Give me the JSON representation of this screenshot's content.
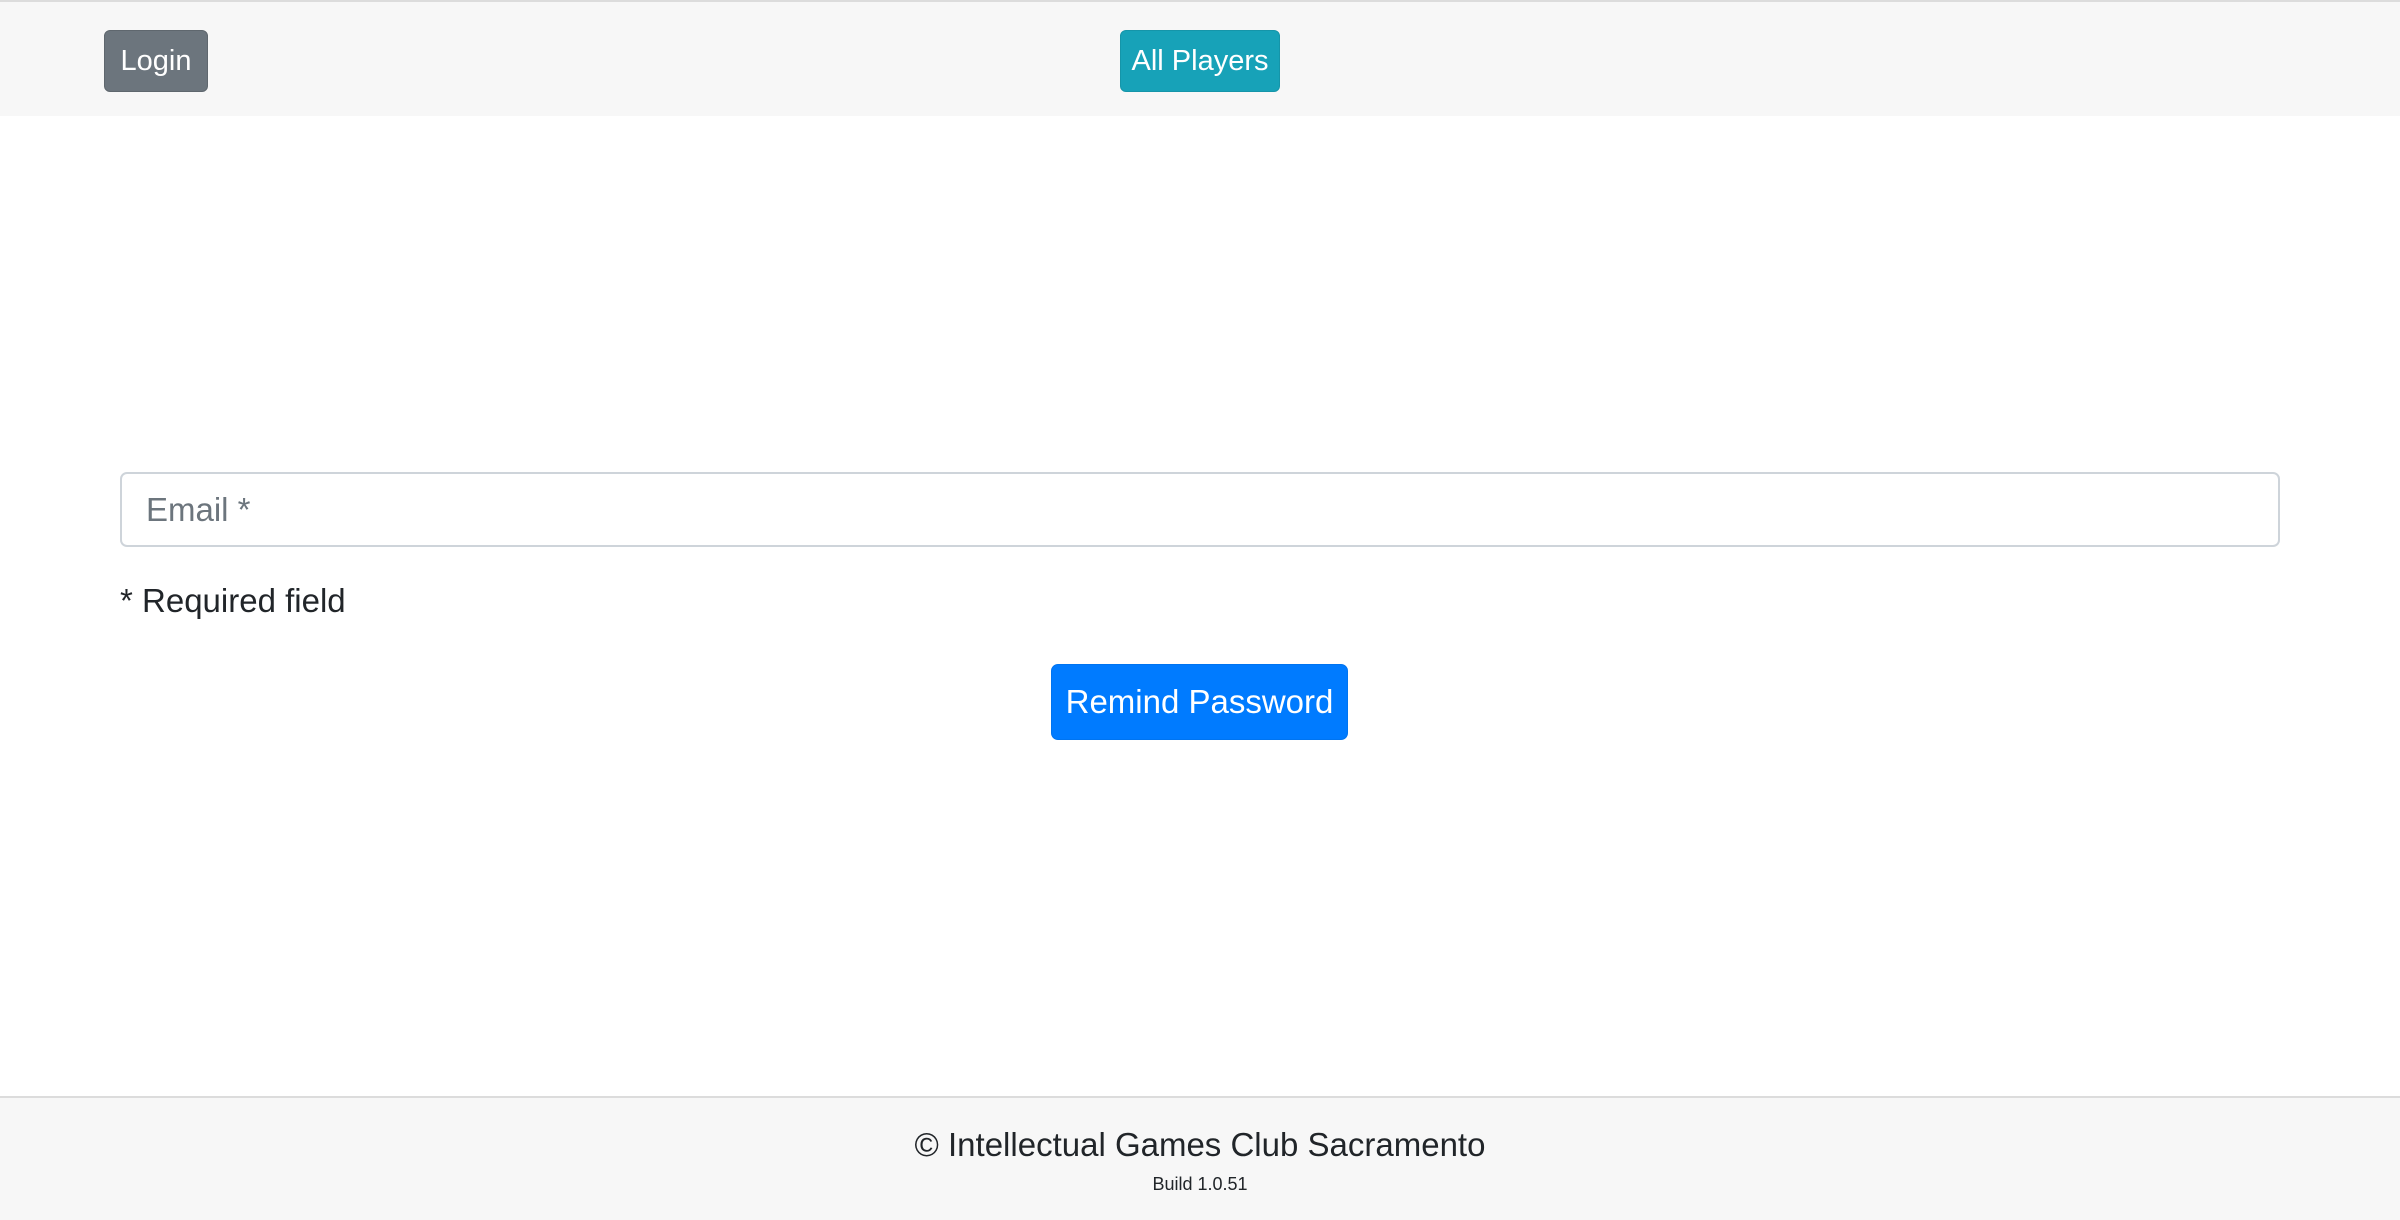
{
  "header": {
    "login_label": "Login",
    "all_players_label": "All Players"
  },
  "form": {
    "email_placeholder": "Email *",
    "email_value": "",
    "required_note": "* Required field",
    "submit_label": "Remind Password"
  },
  "footer": {
    "copyright": "© Intellectual Games Club Sacramento",
    "build": "Build 1.0.51"
  },
  "colors": {
    "header_bg": "#f7f7f7",
    "login_button": "#6c757d",
    "all_players_button": "#17a2b8",
    "primary_button": "#007bff"
  }
}
